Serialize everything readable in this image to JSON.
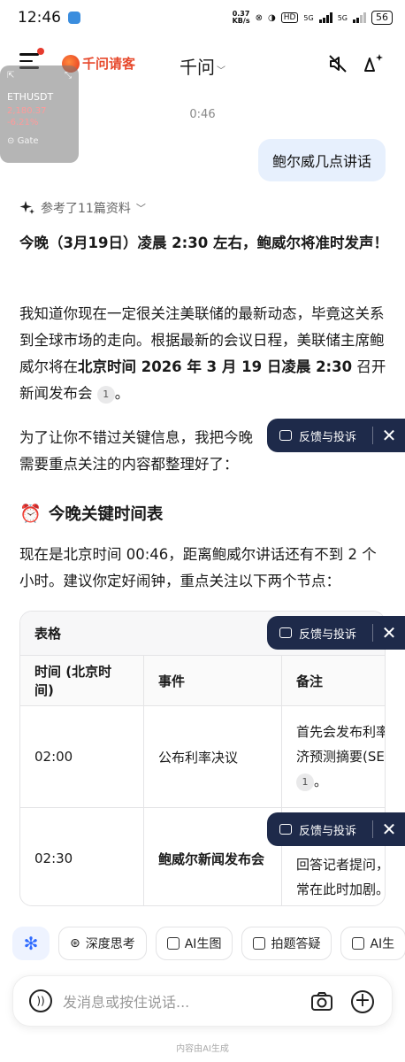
{
  "status": {
    "time": "12:46",
    "net_speed_top": "0.37",
    "net_speed_bottom": "KB/s",
    "hd": "HD",
    "sig1": "5G",
    "sig2": "5G",
    "battery": "56"
  },
  "header": {
    "brand": "千问请客",
    "title": "千问"
  },
  "ticker": {
    "symbol": "ETHUSDT",
    "price": "2,180.37",
    "change": "-6.21%",
    "source": "Gate"
  },
  "chat": {
    "time": "0:46",
    "user_message": "鲍尔威几点讲话",
    "refs_label": "参考了11篇资料",
    "headline": "今晚（3月19日）凌晨 2:30 左右，鲍威尔将准时发声！",
    "p1_a": "我知道你现在一定很关注美联储的最新动态，毕竟这关系到全球市场的走向。根据最新的会议日程，美联储主席鲍威尔将在",
    "p1_bold": "北京时间 2026 年 3 月 19 日凌晨 2:30",
    "p1_b": " 召开新闻发布会",
    "p1_cite": "1",
    "p1_end": "。",
    "p2": "为了让你不错过关键信息，我把今晚",
    "p2_cont": "需要重点关注的内容都整理好了：",
    "section_title": "今晚关键时间表",
    "p3": "现在是北京时间 00:46，距离鲍威尔讲话还有不到 2 个小时。建议你定好闹钟，重点关注以下两个节点："
  },
  "table": {
    "label": "表格",
    "headers": [
      "时间 (北京时间)",
      "事件",
      "备注"
    ],
    "rows": [
      {
        "time": "02:00",
        "event": "公布利率决议",
        "note1": "首先会发布利率",
        "note2": "济预测摘要(SE",
        "cite": "1",
        "note3": "。"
      },
      {
        "time": "02:30",
        "event": "鲍威尔新闻发布会",
        "note1": "",
        "note2": "回答记者提问，",
        "note3": "常在此时加剧。"
      }
    ]
  },
  "feedback": {
    "label": "反馈与投诉",
    "close": "✕"
  },
  "chips": {
    "deep": "深度思考",
    "ai_img": "AI生图",
    "photo_q": "拍题答疑",
    "ai_more": "AI生"
  },
  "input": {
    "placeholder": "发消息或按住说话..."
  },
  "footer": "内容由AI生成"
}
